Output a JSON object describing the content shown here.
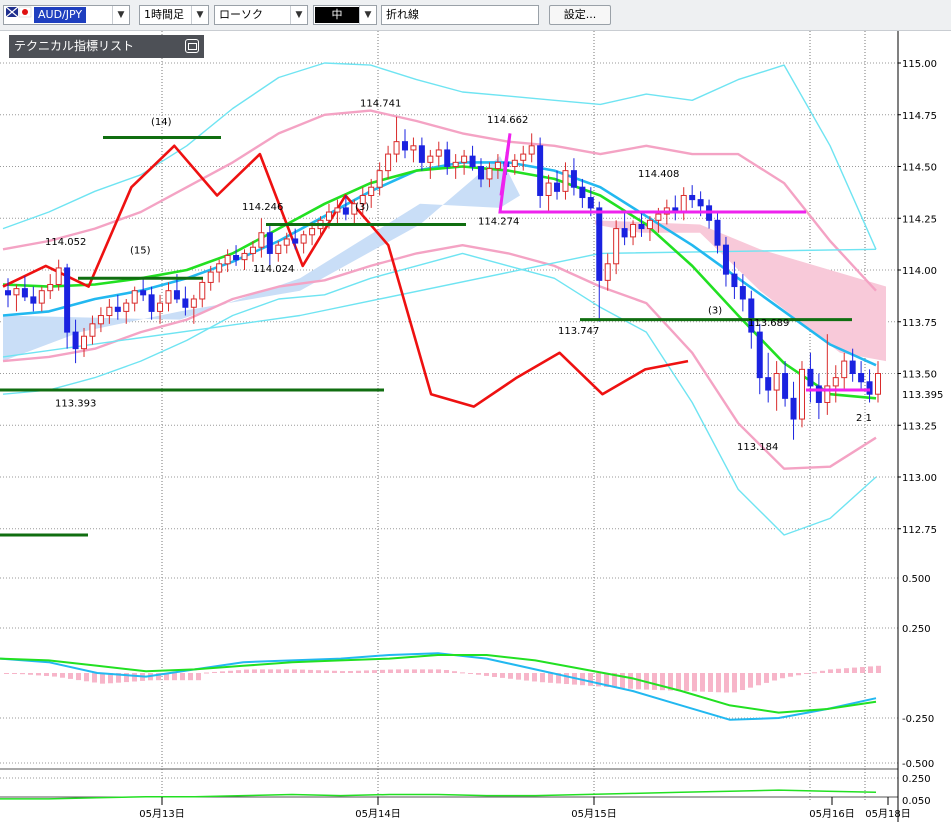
{
  "toolbar": {
    "pair": "AUD/JPY",
    "timeframe": "1時間足",
    "chart_type": "ローソク",
    "mode": "中",
    "line_type": "折れ線",
    "settings": "設定..."
  },
  "indicator_list": {
    "label": "テクニカル指標リスト"
  },
  "colors": {
    "up_candle": "#d92b2b",
    "down_candle": "#1a22e0",
    "ma_green": "#22e022",
    "ma_blue": "#22b8f0",
    "bollinger_pink": "#f4a3c4",
    "bollinger_cyan": "#6fe4f2",
    "rsi_red": "#ee1111",
    "cloud_blue": "#c9def7",
    "cloud_pink": "#f8c9d9",
    "support_green": "#106e10",
    "magenta": "#ee22ee",
    "macd_hist": "#f7b5c9"
  },
  "chart_data": [
    {
      "type": "line",
      "pane": "price",
      "y_ticks": [
        "115.00",
        "114.75",
        "114.50",
        "114.25",
        "114.00",
        "113.75",
        "113.50",
        "113.25",
        "113.00",
        "112.75"
      ],
      "y_range": [
        112.6,
        115.2
      ],
      "current_price_label": "113.395",
      "x_ticks": [
        "05月13日",
        "05月14日",
        "05月15日",
        "05月16日",
        "05月18日"
      ],
      "peak_labels": [
        "114.052",
        "113.393",
        "114.246",
        "114.024",
        "114.741",
        "114.662",
        "114.274",
        "113.747",
        "114.408",
        "113.689",
        "113.184"
      ],
      "count_labels": [
        "(14)",
        "(15)",
        "(3)",
        "(3)",
        "2 1"
      ],
      "series": [
        {
          "kind": "candles",
          "ohlc": [
            [
              113.9,
              113.96,
              113.82,
              113.88
            ],
            [
              113.88,
              113.93,
              113.8,
              113.91
            ],
            [
              113.91,
              113.97,
              113.85,
              113.87
            ],
            [
              113.87,
              113.92,
              113.8,
              113.84
            ],
            [
              113.84,
              113.92,
              113.8,
              113.9
            ],
            [
              113.9,
              113.98,
              113.86,
              113.93
            ],
            [
              113.93,
              114.05,
              113.9,
              114.01
            ],
            [
              114.01,
              114.03,
              113.62,
              113.7
            ],
            [
              113.7,
              113.76,
              113.55,
              113.62
            ],
            [
              113.62,
              113.72,
              113.58,
              113.68
            ],
            [
              113.68,
              113.78,
              113.64,
              113.74
            ],
            [
              113.74,
              113.82,
              113.7,
              113.78
            ],
            [
              113.78,
              113.86,
              113.74,
              113.82
            ],
            [
              113.82,
              113.88,
              113.76,
              113.8
            ],
            [
              113.8,
              113.86,
              113.74,
              113.84
            ],
            [
              113.84,
              113.92,
              113.8,
              113.9
            ],
            [
              113.9,
              113.96,
              113.85,
              113.88
            ],
            [
              113.88,
              113.92,
              113.76,
              113.8
            ],
            [
              113.8,
              113.88,
              113.74,
              113.84
            ],
            [
              113.84,
              113.94,
              113.8,
              113.9
            ],
            [
              113.9,
              113.98,
              113.84,
              113.86
            ],
            [
              113.86,
              113.92,
              113.78,
              113.82
            ],
            [
              113.82,
              113.88,
              113.74,
              113.86
            ],
            [
              113.86,
              113.96,
              113.82,
              113.94
            ],
            [
              113.94,
              114.02,
              113.9,
              113.99
            ],
            [
              113.99,
              114.05,
              113.94,
              114.03
            ],
            [
              114.03,
              114.1,
              113.99,
              114.07
            ],
            [
              114.07,
              114.12,
              114.02,
              114.05
            ],
            [
              114.05,
              114.1,
              114.0,
              114.08
            ],
            [
              114.08,
              114.14,
              114.04,
              114.11
            ],
            [
              114.11,
              114.25,
              114.06,
              114.18
            ],
            [
              114.18,
              114.22,
              114.02,
              114.08
            ],
            [
              114.08,
              114.14,
              114.04,
              114.12
            ],
            [
              114.12,
              114.18,
              114.08,
              114.15
            ],
            [
              114.15,
              114.2,
              114.1,
              114.13
            ],
            [
              114.13,
              114.19,
              114.08,
              114.17
            ],
            [
              114.17,
              114.23,
              114.12,
              114.2
            ],
            [
              114.2,
              114.26,
              114.16,
              114.24
            ],
            [
              114.24,
              114.32,
              114.2,
              114.28
            ],
            [
              114.28,
              114.34,
              114.22,
              114.3
            ],
            [
              114.3,
              114.36,
              114.24,
              114.27
            ],
            [
              114.27,
              114.34,
              114.22,
              114.32
            ],
            [
              114.32,
              114.4,
              114.26,
              114.36
            ],
            [
              114.36,
              114.44,
              114.3,
              114.4
            ],
            [
              114.4,
              114.52,
              114.36,
              114.48
            ],
            [
              114.48,
              114.6,
              114.44,
              114.56
            ],
            [
              114.56,
              114.74,
              114.52,
              114.62
            ],
            [
              114.62,
              114.68,
              114.54,
              114.58
            ],
            [
              114.58,
              114.64,
              114.52,
              114.6
            ],
            [
              114.6,
              114.64,
              114.48,
              114.52
            ],
            [
              114.52,
              114.58,
              114.44,
              114.55
            ],
            [
              114.55,
              114.62,
              114.5,
              114.58
            ],
            [
              114.58,
              114.62,
              114.46,
              114.5
            ],
            [
              114.5,
              114.56,
              114.44,
              114.52
            ],
            [
              114.52,
              114.58,
              114.46,
              114.55
            ],
            [
              114.55,
              114.6,
              114.48,
              114.5
            ],
            [
              114.5,
              114.54,
              114.4,
              114.44
            ],
            [
              114.44,
              114.52,
              114.4,
              114.49
            ],
            [
              114.49,
              114.56,
              114.44,
              114.52
            ],
            [
              114.52,
              114.57,
              114.46,
              114.5
            ],
            [
              114.5,
              114.56,
              114.46,
              114.53
            ],
            [
              114.53,
              114.6,
              114.48,
              114.56
            ],
            [
              114.56,
              114.66,
              114.52,
              114.6
            ],
            [
              114.6,
              114.64,
              114.3,
              114.36
            ],
            [
              114.36,
              114.46,
              114.28,
              114.42
            ],
            [
              114.42,
              114.48,
              114.34,
              114.38
            ],
            [
              114.38,
              114.52,
              114.34,
              114.48
            ],
            [
              114.48,
              114.54,
              114.36,
              114.4
            ],
            [
              114.4,
              114.44,
              114.3,
              114.35
            ],
            [
              114.35,
              114.4,
              114.26,
              114.3
            ],
            [
              114.3,
              114.33,
              113.75,
              113.95
            ],
            [
              113.95,
              114.08,
              113.9,
              114.03
            ],
            [
              114.03,
              114.24,
              113.98,
              114.2
            ],
            [
              114.2,
              114.28,
              114.12,
              114.16
            ],
            [
              114.16,
              114.24,
              114.12,
              114.22
            ],
            [
              114.22,
              114.28,
              114.16,
              114.2
            ],
            [
              114.2,
              114.26,
              114.14,
              114.24
            ],
            [
              114.24,
              114.3,
              114.18,
              114.27
            ],
            [
              114.27,
              114.34,
              114.22,
              114.3
            ],
            [
              114.3,
              114.36,
              114.24,
              114.28
            ],
            [
              114.28,
              114.4,
              114.24,
              114.36
            ],
            [
              114.36,
              114.41,
              114.3,
              114.34
            ],
            [
              114.34,
              114.38,
              114.26,
              114.31
            ],
            [
              114.31,
              114.34,
              114.2,
              114.24
            ],
            [
              114.24,
              114.28,
              114.08,
              114.12
            ],
            [
              114.12,
              114.16,
              113.92,
              113.98
            ],
            [
              113.98,
              114.04,
              113.86,
              113.92
            ],
            [
              113.92,
              113.98,
              113.8,
              113.86
            ],
            [
              113.86,
              113.9,
              113.62,
              113.7
            ],
            [
              113.7,
              113.74,
              113.4,
              113.48
            ],
            [
              113.48,
              113.6,
              113.36,
              113.42
            ],
            [
              113.42,
              113.56,
              113.32,
              113.5
            ],
            [
              113.5,
              113.56,
              113.34,
              113.38
            ],
            [
              113.38,
              113.46,
              113.18,
              113.28
            ],
            [
              113.28,
              113.56,
              113.24,
              113.52
            ],
            [
              113.52,
              113.6,
              113.36,
              113.44
            ],
            [
              113.44,
              113.5,
              113.28,
              113.36
            ],
            [
              113.36,
              113.69,
              113.3,
              113.44
            ],
            [
              113.44,
              113.54,
              113.36,
              113.48
            ],
            [
              113.48,
              113.6,
              113.42,
              113.56
            ],
            [
              113.56,
              113.62,
              113.46,
              113.5
            ],
            [
              113.5,
              113.56,
              113.42,
              113.46
            ],
            [
              113.46,
              113.52,
              113.36,
              113.4
            ],
            [
              113.4,
              113.56,
              113.36,
              113.5
            ]
          ]
        },
        {
          "kind": "ma_green",
          "values": [
            113.93,
            113.92,
            113.93,
            113.96,
            114.0,
            114.08,
            114.2,
            114.32,
            114.42,
            114.48,
            114.5,
            114.48,
            114.44,
            114.36,
            114.22,
            114.02,
            113.78,
            113.55,
            113.4,
            113.38
          ]
        },
        {
          "kind": "ma_blue",
          "values": [
            113.78,
            113.8,
            113.86,
            113.9,
            113.96,
            114.04,
            114.14,
            114.26,
            114.38,
            114.48,
            114.52,
            114.52,
            114.48,
            114.4,
            114.26,
            114.12,
            113.96,
            113.8,
            113.64,
            113.54
          ]
        },
        {
          "kind": "bollinger_pink_upper",
          "values": [
            114.1,
            114.14,
            114.2,
            114.28,
            114.4,
            114.52,
            114.66,
            114.75,
            114.77,
            114.72,
            114.66,
            114.62,
            114.6,
            114.56,
            114.6,
            114.56,
            114.56,
            114.42,
            114.14,
            113.9
          ]
        },
        {
          "kind": "bollinger_pink_lower",
          "values": [
            113.56,
            113.58,
            113.62,
            113.7,
            113.76,
            113.86,
            113.92,
            113.95,
            114.02,
            114.08,
            114.12,
            114.08,
            114.02,
            113.92,
            113.84,
            113.6,
            113.26,
            113.04,
            113.05,
            113.19
          ]
        },
        {
          "kind": "bollinger_cyan_upper",
          "values": [
            114.2,
            114.28,
            114.38,
            114.46,
            114.6,
            114.78,
            114.93,
            115.0,
            114.99,
            114.92,
            114.86,
            114.84,
            114.82,
            114.8,
            114.85,
            114.82,
            114.92,
            114.99,
            114.6,
            114.1
          ]
        },
        {
          "kind": "bollinger_cyan_lower",
          "values": [
            113.4,
            113.42,
            113.48,
            113.56,
            113.66,
            113.78,
            113.86,
            113.88,
            113.96,
            114.02,
            114.08,
            114.02,
            113.96,
            113.82,
            113.7,
            113.36,
            112.94,
            112.72,
            112.8,
            113.0
          ]
        },
        {
          "kind": "rsi_red",
          "values": [
            113.92,
            114.02,
            113.92,
            114.4,
            114.6,
            114.36,
            114.56,
            114.02,
            114.36,
            114.12,
            113.4,
            113.34,
            113.48,
            113.6,
            113.4,
            113.52,
            113.56
          ]
        }
      ]
    },
    {
      "type": "line",
      "pane": "macd",
      "y_ticks": [
        "0.500",
        "0.250",
        "-0.250",
        "-0.500"
      ],
      "y_range": [
        -0.55,
        0.62
      ],
      "series": [
        {
          "name": "",
          "values": [
            0.08,
            0.06,
            0.0,
            -0.02,
            0.02,
            0.06,
            0.07,
            0.08,
            0.1,
            0.11,
            0.08,
            0.02,
            -0.04,
            -0.1,
            -0.18,
            -0.26,
            -0.25,
            -0.2,
            -0.14
          ]
        },
        {
          "name": "",
          "values": [
            0.08,
            0.07,
            0.04,
            0.01,
            0.02,
            0.04,
            0.06,
            0.07,
            0.08,
            0.1,
            0.1,
            0.07,
            0.02,
            -0.03,
            -0.1,
            -0.18,
            -0.22,
            -0.2,
            -0.16
          ]
        },
        {
          "name": "",
          "values": [
            0.0,
            -0.02,
            -0.06,
            -0.04,
            0.0,
            0.02,
            0.02,
            0.01,
            0.02,
            0.02,
            -0.02,
            -0.05,
            -0.07,
            -0.09,
            -0.1,
            -0.11,
            -0.03,
            0.02,
            0.04
          ]
        }
      ]
    },
    {
      "type": "line",
      "pane": "oscillator",
      "y_ticks": [
        "0.250",
        "0.050"
      ],
      "y_range": [
        0.0,
        0.3
      ],
      "series": [
        {
          "name": "",
          "values": [
            0.06,
            0.06,
            0.07,
            0.08,
            0.08,
            0.09,
            0.1,
            0.09,
            0.1,
            0.1,
            0.09,
            0.09,
            0.1,
            0.11,
            0.12,
            0.13,
            0.14,
            0.13,
            0.12
          ]
        }
      ]
    }
  ]
}
